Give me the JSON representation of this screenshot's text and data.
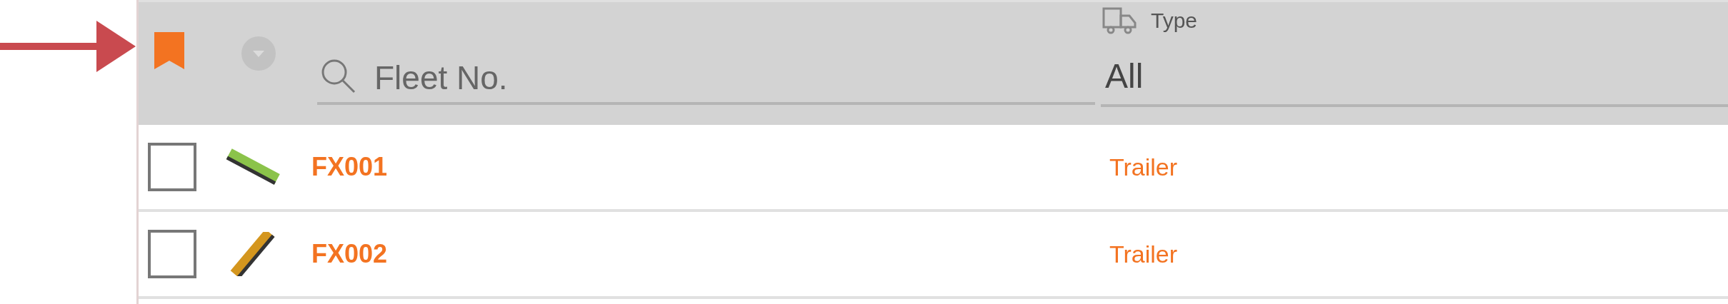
{
  "header": {
    "fleet_search": {
      "placeholder": "Fleet No."
    },
    "type_filter": {
      "label": "Type",
      "value": "All"
    }
  },
  "rows": [
    {
      "checked": false,
      "color": "#8bc34a",
      "fleet_no": "FX001",
      "type": "Trailer"
    },
    {
      "checked": false,
      "color": "#d4961e",
      "fleet_no": "FX002",
      "type": "Trailer"
    }
  ]
}
